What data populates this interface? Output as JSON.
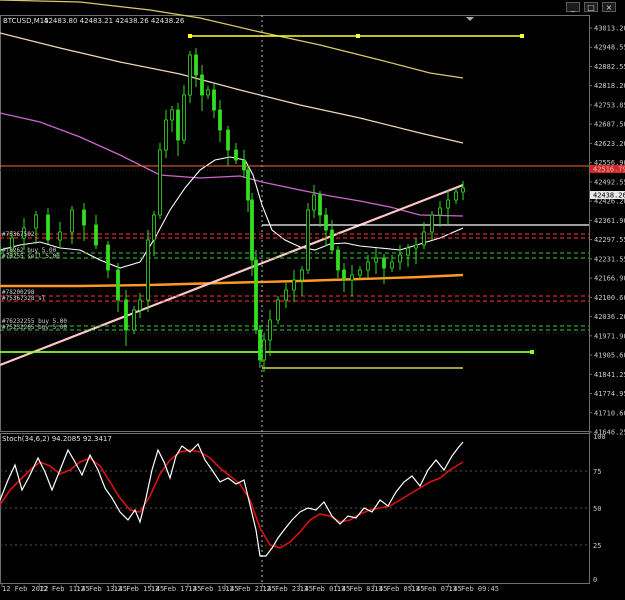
{
  "header": {
    "symbol_label": "BTCUSD,M15",
    "ohlc_label": "42483.80 42483.21 42438.26 42438.26"
  },
  "window_buttons": [
    {
      "name": "minimize",
      "glyph": "_"
    },
    {
      "name": "maximize",
      "glyph": "□"
    },
    {
      "name": "close",
      "glyph": "×"
    }
  ],
  "price_axis": {
    "labels": [
      "43013.20",
      "42948.55",
      "42882.55",
      "42818.20",
      "42753.85",
      "42687.50",
      "42623.20",
      "42556.90",
      "42492.55",
      "42426.20",
      "42361.90",
      "42297.55",
      "42231.55",
      "42166.90",
      "42100.60",
      "42036.20",
      "41971.90",
      "41905.60",
      "41841.25",
      "41774.95",
      "41710.60",
      "41646.25"
    ],
    "current_price_tag": "42516.79",
    "bid_tag": "42438.26"
  },
  "stoch_panel": {
    "title": "Stoch(34,6,2) 94.2085 92.3417",
    "levels": [
      "100",
      "75",
      "50",
      "25",
      "0"
    ]
  },
  "time_axis": {
    "labels": [
      "12 Feb 2022",
      "12 Feb 11:45",
      "12 Feb 13:45",
      "12 Feb 15:45",
      "12 Feb 17:45",
      "12 Feb 19:45",
      "12 Feb 21:45",
      "12 Feb 23:45",
      "13 Feb 01:45",
      "13 Feb 03:45",
      "13 Feb 05:45",
      "13 Feb 07:45",
      "13 Feb 09:45"
    ]
  },
  "order_labels": [
    "#75367502",
    "#78262 buy 5.00",
    "#76255 sell 5.00",
    "#78200298",
    "#75367328 sl",
    "#76232255 buy 5.00",
    "#75232265 buy 5.00"
  ],
  "colors": {
    "background": "#000000",
    "grid": "#2e2e2e",
    "candle": "#33dd22",
    "ma_fast": "#ffffff",
    "ma_orange": "#ff9922",
    "ma_purple": "#cc66cc",
    "ma_tan": "#f0d8b8",
    "ma_yellow": "#d8cc66",
    "trendline": "#ffc8c8",
    "level_yellow": "#ffff33",
    "level_green": "#88ff22",
    "level_red": "#ff3333",
    "stoch_main": "#ffffff",
    "stoch_signal": "#dd1111"
  }
}
